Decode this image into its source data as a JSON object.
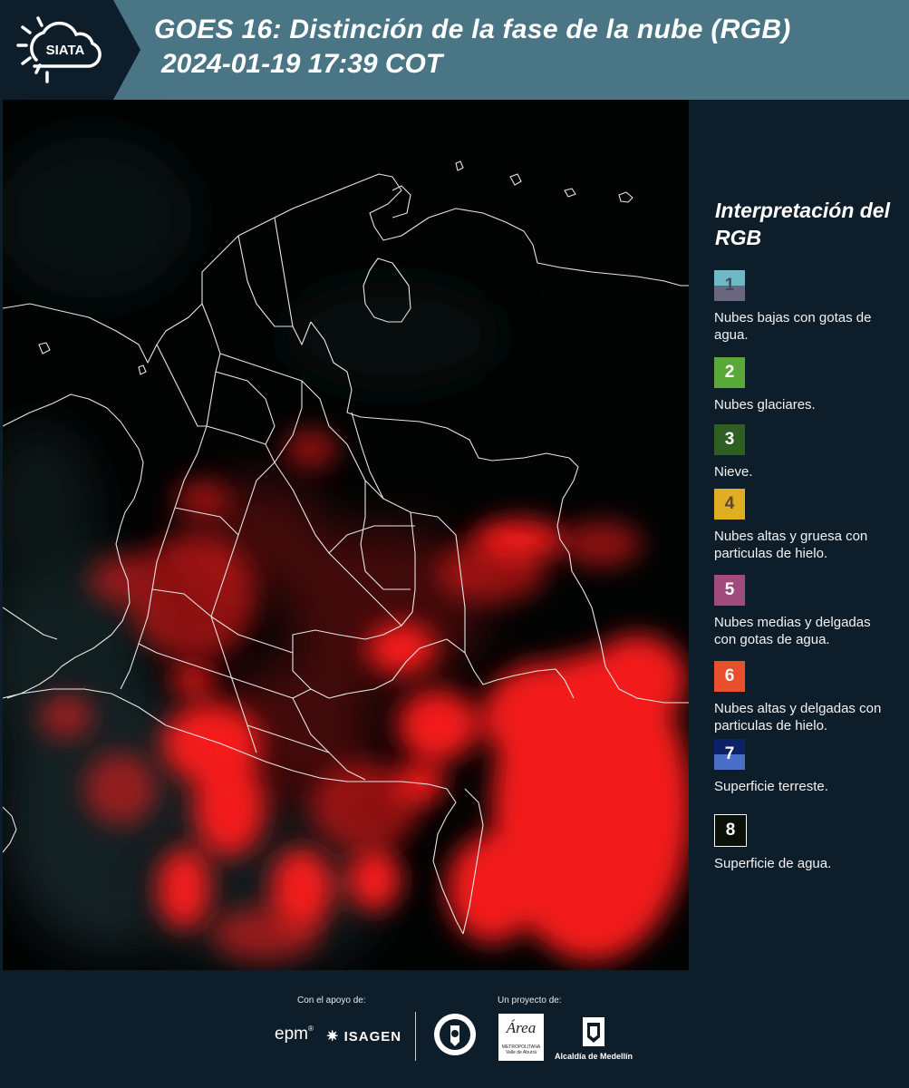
{
  "header": {
    "logo_text": "SIATA",
    "title_line1": "GOES 16: Distinción de la fase de la nube (RGB)",
    "title_line2": "2024-01-19 17:39 COT"
  },
  "legend": {
    "title": "Interpretación del RGB",
    "items": [
      {
        "number": "1",
        "label": "Nubes bajas con gotas de agua.",
        "color_top": "#6fb9c6",
        "color_bottom": "#6b6680",
        "text_color": "#404a5a"
      },
      {
        "number": "2",
        "label": "Nubes glaciares.",
        "color_top": "#5aa73a",
        "color_bottom": "#5aa73a",
        "text_color": "#ffffff"
      },
      {
        "number": "3",
        "label": "Nieve.",
        "color_top": "#2f5e24",
        "color_bottom": "#2f5e24",
        "text_color": "#ffffff"
      },
      {
        "number": "4",
        "label": "Nubes altas y gruesa con particulas de hielo.",
        "color_top": "#e0ae23",
        "color_bottom": "#e0ae23",
        "text_color": "#5a4a2a"
      },
      {
        "number": "5",
        "label": "Nubes medias y delgadas con gotas de agua.",
        "color_top": "#a14a7c",
        "color_bottom": "#a14a7c",
        "text_color": "#ffffff"
      },
      {
        "number": "6",
        "label": "Nubes altas y delgadas con particulas de hielo.",
        "color_top": "#e8502b",
        "color_bottom": "#e8502b",
        "text_color": "#ffffff"
      },
      {
        "number": "7",
        "label": "Superficie terreste.",
        "color_top": "#0d2266",
        "color_bottom": "#4a6fc8",
        "text_color": "#ffffff"
      },
      {
        "number": "8",
        "label": "Superficie de agua.",
        "color_top": "#0a0f08",
        "color_bottom": "#0a0f08",
        "text_color": "#ffffff"
      }
    ]
  },
  "footer": {
    "support_label": "Con el apoyo de:",
    "project_label": "Un proyecto de:",
    "sponsor_epm": "epm",
    "sponsor_isagen": "ISAGEN",
    "area_logo_text": "Área",
    "area_logo_sub": "METROPOLITANA",
    "area_logo_sub2": "Valle de Aburrá",
    "alcaldia": "Alcaldía de Medellín"
  },
  "colors": {
    "header_bg": "#4a7585",
    "page_bg": "#0e1d2a",
    "cloud_red": "#ff1f1f"
  }
}
